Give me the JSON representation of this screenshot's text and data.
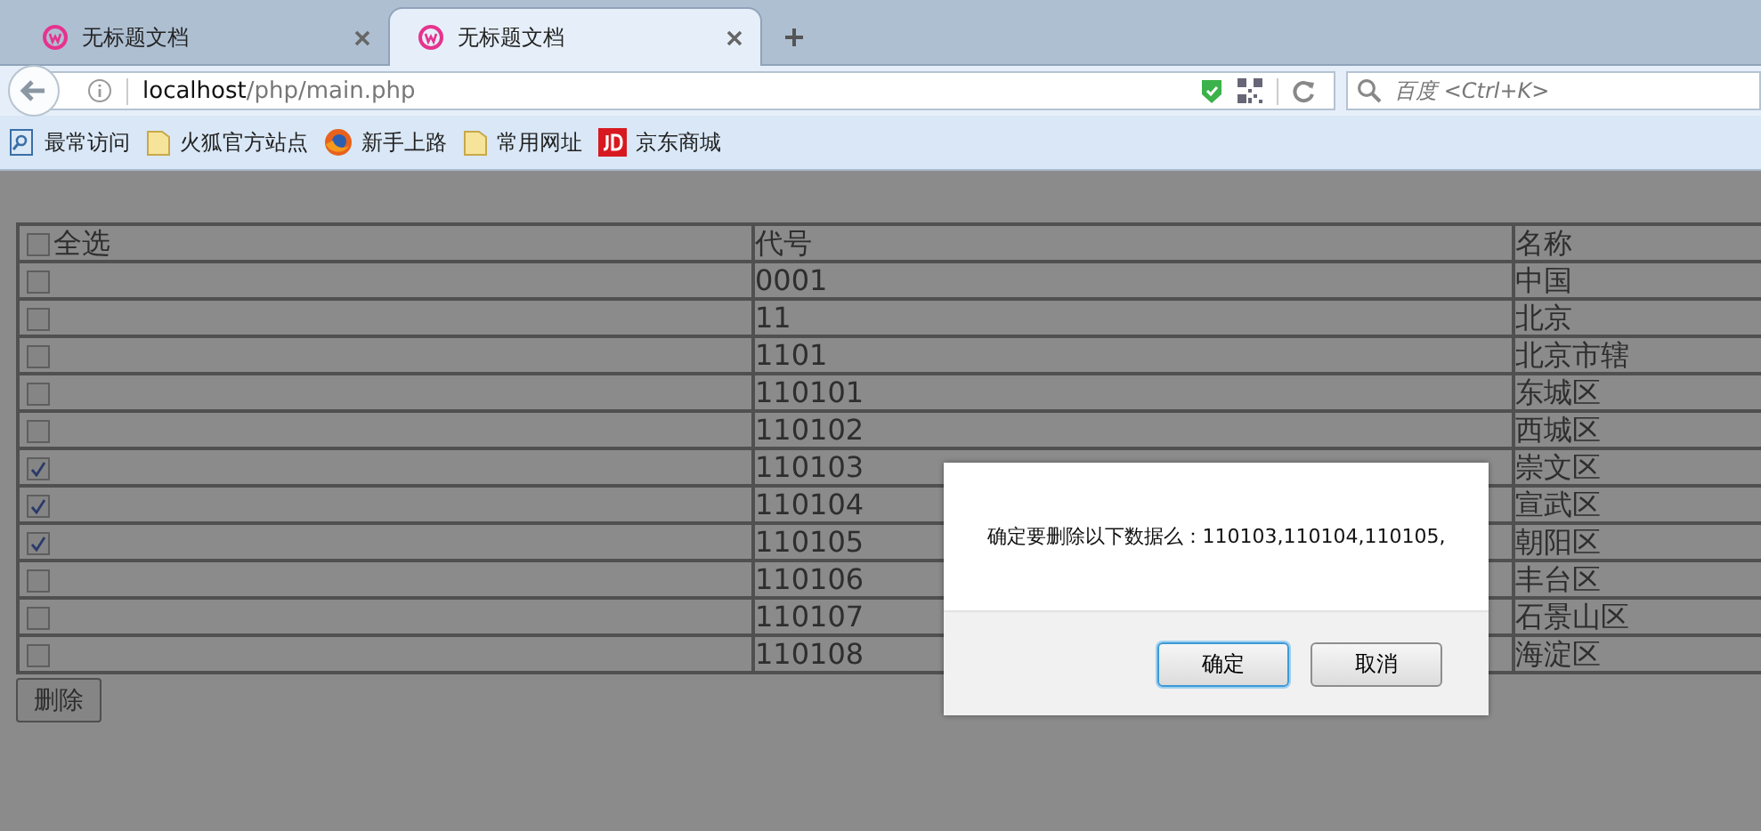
{
  "browser": {
    "tabs": [
      {
        "title": "无标题文档",
        "selected": false
      },
      {
        "title": "无标题文档",
        "selected": true
      }
    ],
    "url": {
      "host": "localhost",
      "path": "/php/main.php"
    },
    "search": {
      "placeholder": "百度 <Ctrl+K>"
    },
    "bookmarks": [
      {
        "label": "最常访问",
        "kind": "page"
      },
      {
        "label": "火狐官方站点",
        "kind": "folder"
      },
      {
        "label": "新手上路",
        "kind": "firefox"
      },
      {
        "label": "常用网址",
        "kind": "folder"
      },
      {
        "label": "京东商城",
        "kind": "jd"
      }
    ]
  },
  "table": {
    "select_all": {
      "label": "全选",
      "checked": false
    },
    "columns": [
      "代号",
      "名称"
    ],
    "rows": [
      {
        "checked": false,
        "code": "0001",
        "name": "中国"
      },
      {
        "checked": false,
        "code": "11",
        "name": "北京"
      },
      {
        "checked": false,
        "code": "1101",
        "name": "北京市辖"
      },
      {
        "checked": false,
        "code": "110101",
        "name": "东城区"
      },
      {
        "checked": false,
        "code": "110102",
        "name": "西城区"
      },
      {
        "checked": true,
        "code": "110103",
        "name": "崇文区"
      },
      {
        "checked": true,
        "code": "110104",
        "name": "宣武区"
      },
      {
        "checked": true,
        "code": "110105",
        "name": "朝阳区"
      },
      {
        "checked": false,
        "code": "110106",
        "name": "丰台区"
      },
      {
        "checked": false,
        "code": "110107",
        "name": "石景山区"
      },
      {
        "checked": false,
        "code": "110108",
        "name": "海淀区"
      }
    ]
  },
  "delete_button": "删除",
  "dialog": {
    "message": "确定要删除以下数据么：110103,110104,110105,",
    "buttons": [
      {
        "label": "确定",
        "focused": true
      },
      {
        "label": "取消",
        "focused": false
      }
    ]
  }
}
